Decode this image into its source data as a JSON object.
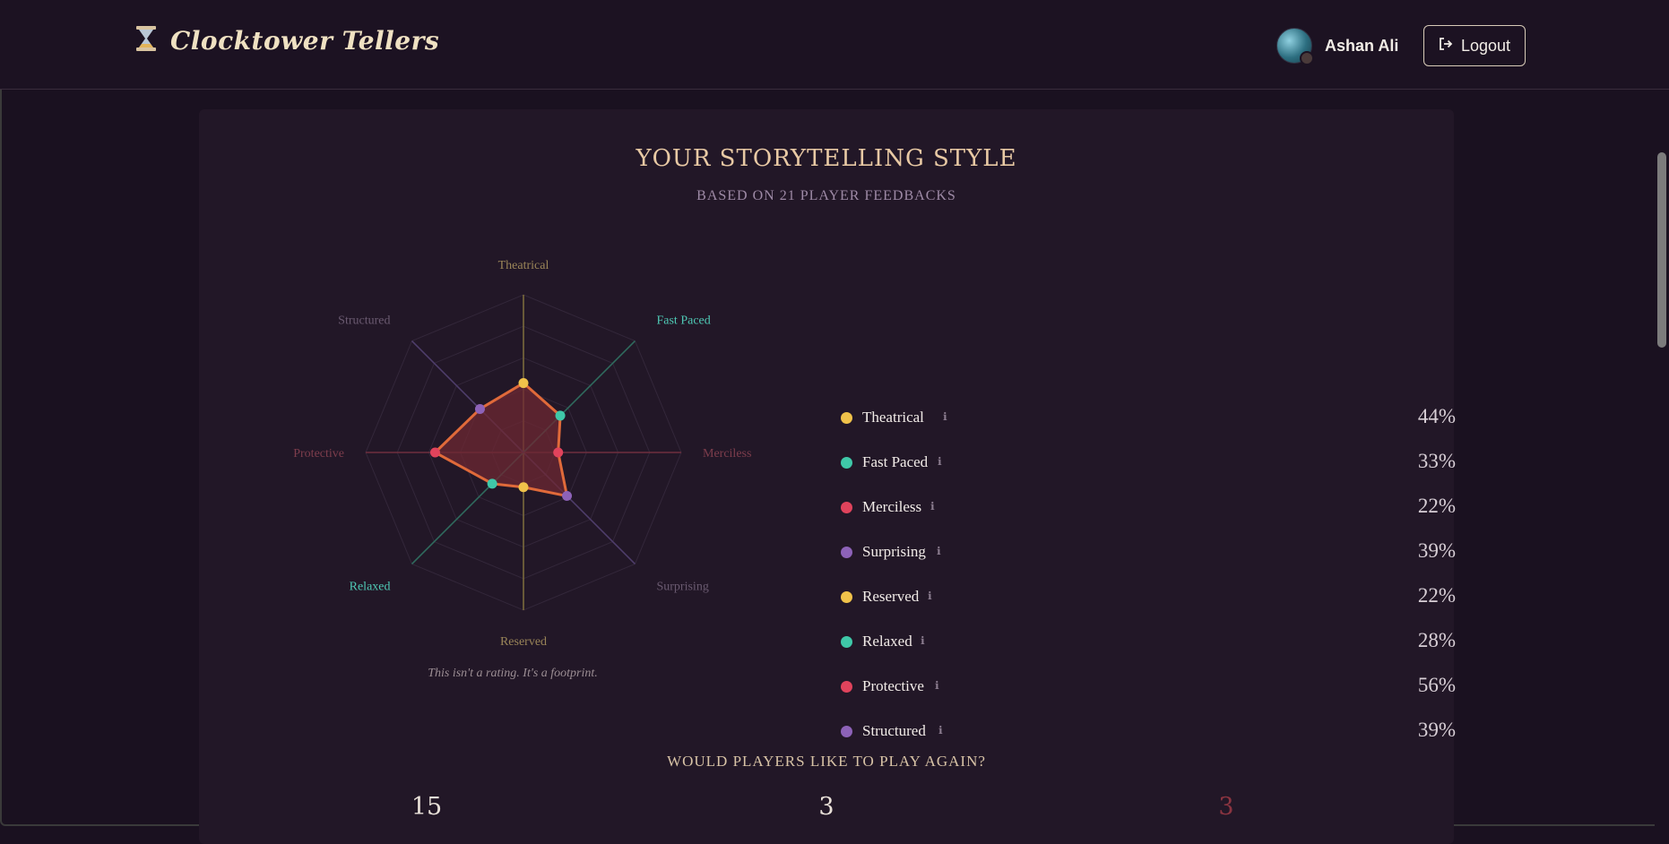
{
  "header": {
    "brand": "Clocktower Tellers",
    "brand_icon": "hourglass-icon",
    "user_name": "Ashan Ali",
    "logout_label": "Logout",
    "logout_icon": "logout-icon"
  },
  "style_section": {
    "title": "YOUR STORYTELLING STYLE",
    "subtitle": "BASED ON 21 PLAYER FEEDBACKS",
    "caption": "This isn't a rating. It's a footprint."
  },
  "chart_data": {
    "type": "radar",
    "axes": [
      "Theatrical",
      "Fast Paced",
      "Merciless",
      "Surprising",
      "Reserved",
      "Relaxed",
      "Protective",
      "Structured"
    ],
    "values": [
      44,
      33,
      22,
      39,
      22,
      28,
      56,
      39
    ],
    "max": 100,
    "rings": 5,
    "axis_colors": [
      "#7a6a3c",
      "#2f6a5e",
      "#6e2f3e",
      "#4e3d6a",
      "#7a6a3c",
      "#2f6a5e",
      "#6e2f3e",
      "#4e3d6a"
    ],
    "label_colors": [
      "#9a8558",
      "#4fc8b4",
      "#7d3d4c",
      "#6a5a70",
      "#9a8558",
      "#4fc8b4",
      "#7d3d4c",
      "#6a5a70"
    ],
    "point_colors": [
      "#f0c24a",
      "#3fc8a8",
      "#e0435c",
      "#8d62b8",
      "#f0c24a",
      "#3fc8a8",
      "#e0435c",
      "#8d62b8"
    ],
    "fill": "#6e2833",
    "stroke": "#e06a3a"
  },
  "legend": [
    {
      "label": "Theatrical",
      "value": "44%",
      "color": "#f0c24a"
    },
    {
      "label": "Fast Paced",
      "value": "33%",
      "color": "#3fc8a8"
    },
    {
      "label": "Merciless",
      "value": "22%",
      "color": "#e0435c"
    },
    {
      "label": "Surprising",
      "value": "39%",
      "color": "#8d62b8"
    },
    {
      "label": "Reserved",
      "value": "22%",
      "color": "#f0c24a"
    },
    {
      "label": "Relaxed",
      "value": "28%",
      "color": "#3fc8a8"
    },
    {
      "label": "Protective",
      "value": "56%",
      "color": "#e0435c"
    },
    {
      "label": "Structured",
      "value": "39%",
      "color": "#8d62b8"
    }
  ],
  "info_glyph": "ℹ",
  "play_again": {
    "title": "WOULD PLAYERS LIKE TO PLAY AGAIN?",
    "stats": [
      {
        "value": "15",
        "color": "#e8e0d8"
      },
      {
        "value": "3",
        "color": "#e8e0d8"
      },
      {
        "value": "3",
        "color": "#8a3440"
      }
    ]
  }
}
